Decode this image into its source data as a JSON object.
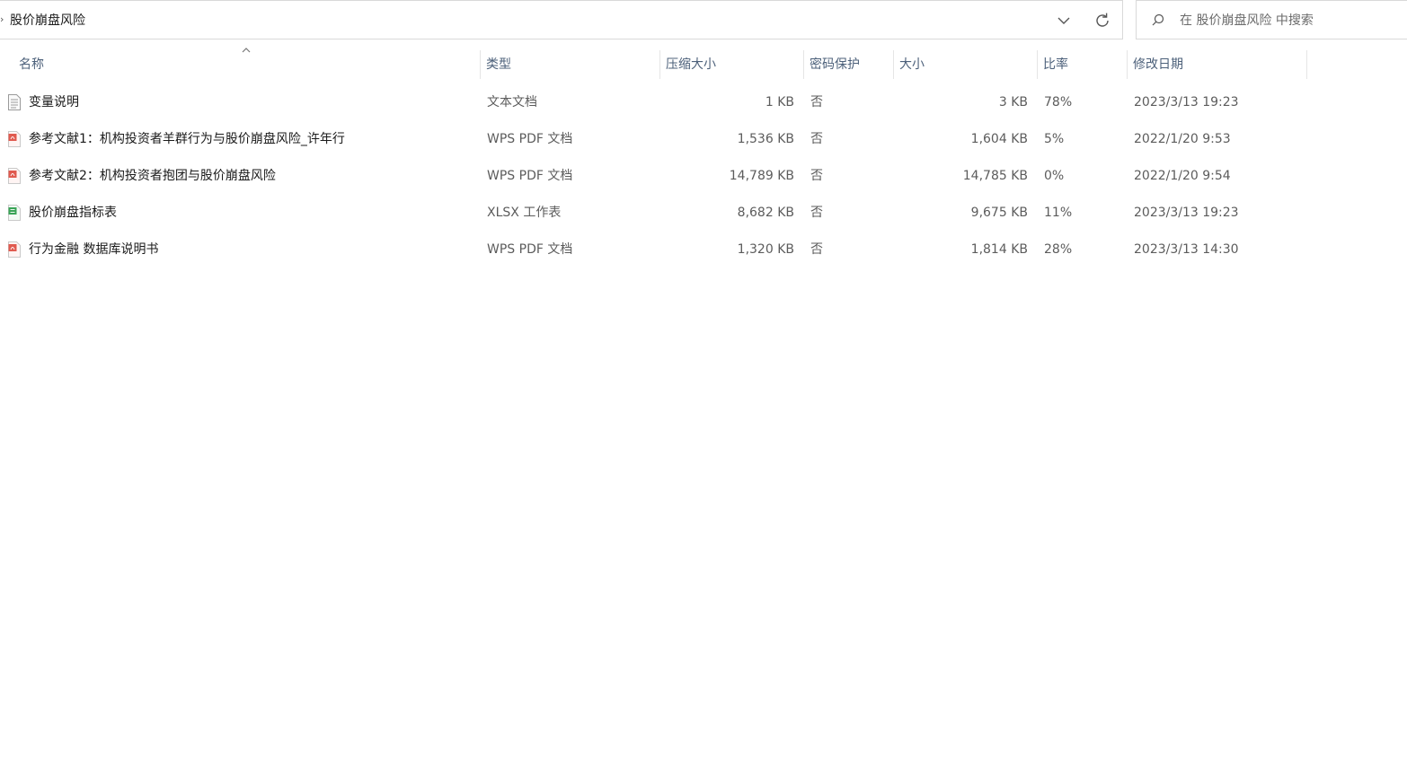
{
  "address": {
    "path": "股价崩盘风险"
  },
  "search": {
    "placeholder": "在 股价崩盘风险 中搜索",
    "value": ""
  },
  "columns": {
    "name": "名称",
    "type": "类型",
    "compressed_size": "压缩大小",
    "password": "密码保护",
    "size": "大小",
    "ratio": "比率",
    "modified": "修改日期"
  },
  "sort": {
    "column": "name",
    "direction": "ascending",
    "icon": "chevron-up-icon"
  },
  "files": [
    {
      "name": "变量说明",
      "icon": "text-document-icon",
      "type": "文本文档",
      "compressed_size": "1 KB",
      "password": "否",
      "size": "3 KB",
      "ratio": "78%",
      "modified": "2023/3/13 19:23"
    },
    {
      "name": "参考文献1：机构投资者羊群行为与股价崩盘风险_许年行",
      "icon": "pdf-icon",
      "type": "WPS PDF 文档",
      "compressed_size": "1,536 KB",
      "password": "否",
      "size": "1,604 KB",
      "ratio": "5%",
      "modified": "2022/1/20 9:53"
    },
    {
      "name": "参考文献2：机构投资者抱团与股价崩盘风险",
      "icon": "pdf-icon",
      "type": "WPS PDF 文档",
      "compressed_size": "14,789 KB",
      "password": "否",
      "size": "14,785 KB",
      "ratio": "0%",
      "modified": "2022/1/20 9:54"
    },
    {
      "name": "股价崩盘指标表",
      "icon": "spreadsheet-icon",
      "type": "XLSX 工作表",
      "compressed_size": "8,682 KB",
      "password": "否",
      "size": "9,675 KB",
      "ratio": "11%",
      "modified": "2023/3/13 19:23"
    },
    {
      "name": "行为金融 数据库说明书",
      "icon": "pdf-icon",
      "type": "WPS PDF 文档",
      "compressed_size": "1,320 KB",
      "password": "否",
      "size": "1,814 KB",
      "ratio": "28%",
      "modified": "2023/3/13 14:30"
    }
  ],
  "colors": {
    "header_text": "#4c607a",
    "cell_text": "#5c5c5c",
    "name_text": "#1b1b1b",
    "border": "#d9d9d9",
    "pdf_icon": "#e05a4f",
    "xlsx_icon": "#3aa457",
    "txt_icon": "#9a9a9a"
  }
}
